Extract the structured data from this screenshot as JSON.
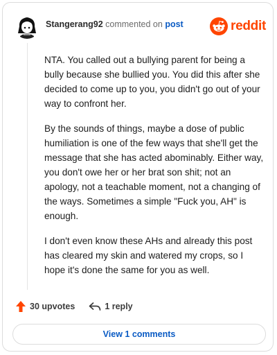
{
  "header": {
    "username": "Stangerang92",
    "commented_text": "commented on",
    "post_link": "post",
    "logo_text": "reddit",
    "icons": {
      "avatar": "avatar",
      "logo": "reddit-alien-icon"
    }
  },
  "comment": {
    "paragraphs": [
      "NTA. You called out a bullying parent for being a bully because she bullied you. You did this after she decided to come up to you, you didn't go out of your way to confront her.",
      "By the sounds of things, maybe a dose of public humiliation is one of the few ways that she'll get the message that she has acted abominably. Either way, you don't owe her or her brat son shit; not an apology, not a teachable moment, not a changing of the ways. Sometimes a simple \"Fuck you, AH\" is enough.",
      "I don't even know these AHs and already this post has cleared my skin and watered my crops, so I hope it's done the same for you as well."
    ]
  },
  "actions": {
    "upvotes_label": "30 upvotes",
    "reply_label": "1 reply",
    "icons": {
      "upvote": "upvote-arrow-icon",
      "reply": "reply-arrow-icon"
    }
  },
  "footer": {
    "view_comments_label": "View 1 comments"
  },
  "colors": {
    "brand": "#ff4500",
    "link": "#0a5bc4",
    "text": "#1c1c1c",
    "muted": "#6b6b6b",
    "border": "#dcdcdc"
  }
}
